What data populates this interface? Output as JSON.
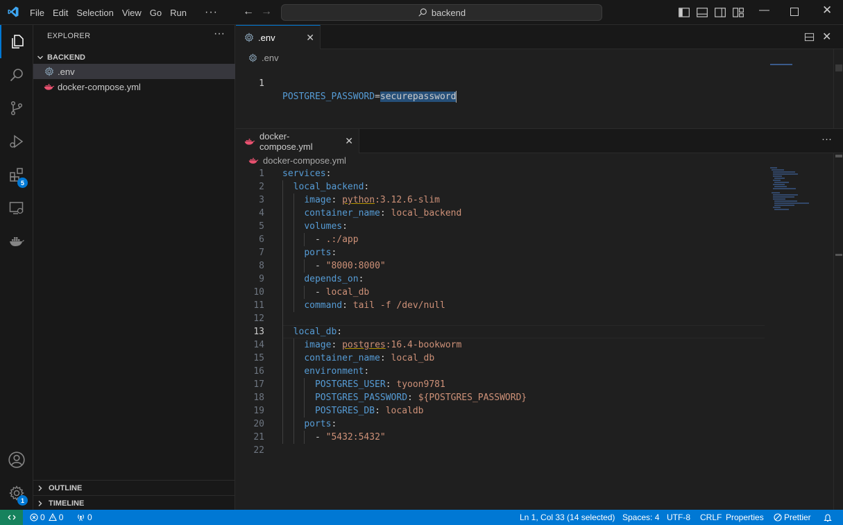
{
  "titlebar": {
    "menu": [
      "File",
      "Edit",
      "Selection",
      "View",
      "Go",
      "Run"
    ],
    "more": "···",
    "search_text": "backend"
  },
  "activity": {
    "extensions_badge": "5",
    "settings_badge": "1"
  },
  "sidebar": {
    "title": "EXPLORER",
    "more": "···",
    "folder": "BACKEND",
    "files": [
      ".env",
      "docker-compose.yml"
    ],
    "outline": "OUTLINE",
    "timeline": "TIMELINE"
  },
  "editor_top": {
    "tab_label": ".env",
    "breadcrumb": ".env",
    "line_number": "1",
    "key": "POSTGRES_PASSWORD",
    "eq": "=",
    "value": "securepassword"
  },
  "editor_bottom": {
    "tab_label": "docker-compose.yml",
    "breadcrumb": "docker-compose.yml",
    "more": "···",
    "current_line": 13,
    "lines": [
      {
        "n": "1",
        "indent": 0,
        "tokens": [
          [
            "k",
            "services"
          ],
          [
            "p",
            ":"
          ]
        ]
      },
      {
        "n": "2",
        "indent": 1,
        "tokens": [
          [
            "k",
            "local_backend"
          ],
          [
            "p",
            ":"
          ]
        ]
      },
      {
        "n": "3",
        "indent": 2,
        "tokens": [
          [
            "k",
            "image"
          ],
          [
            "p",
            ": "
          ],
          [
            "su",
            "python"
          ],
          [
            "s",
            ":3.12.6-slim"
          ]
        ]
      },
      {
        "n": "4",
        "indent": 2,
        "tokens": [
          [
            "k",
            "container_name"
          ],
          [
            "p",
            ": "
          ],
          [
            "s",
            "local_backend"
          ]
        ]
      },
      {
        "n": "5",
        "indent": 2,
        "tokens": [
          [
            "k",
            "volumes"
          ],
          [
            "p",
            ":"
          ]
        ]
      },
      {
        "n": "6",
        "indent": 3,
        "tokens": [
          [
            "p",
            "- "
          ],
          [
            "s",
            ".:/app"
          ]
        ]
      },
      {
        "n": "7",
        "indent": 2,
        "tokens": [
          [
            "k",
            "ports"
          ],
          [
            "p",
            ":"
          ]
        ]
      },
      {
        "n": "8",
        "indent": 3,
        "tokens": [
          [
            "p",
            "- "
          ],
          [
            "s",
            "\"8000:8000\""
          ]
        ]
      },
      {
        "n": "9",
        "indent": 2,
        "tokens": [
          [
            "k",
            "depends_on"
          ],
          [
            "p",
            ":"
          ]
        ]
      },
      {
        "n": "10",
        "indent": 3,
        "tokens": [
          [
            "p",
            "- "
          ],
          [
            "s",
            "local_db"
          ]
        ]
      },
      {
        "n": "11",
        "indent": 2,
        "tokens": [
          [
            "k",
            "command"
          ],
          [
            "p",
            ": "
          ],
          [
            "s",
            "tail -f /dev/null"
          ]
        ]
      },
      {
        "n": "12",
        "indent": 0,
        "tokens": []
      },
      {
        "n": "13",
        "indent": 1,
        "tokens": [
          [
            "k",
            "local_db"
          ],
          [
            "p",
            ":"
          ]
        ]
      },
      {
        "n": "14",
        "indent": 2,
        "tokens": [
          [
            "k",
            "image"
          ],
          [
            "p",
            ": "
          ],
          [
            "su",
            "postgres"
          ],
          [
            "s",
            ":16.4-bookworm"
          ]
        ]
      },
      {
        "n": "15",
        "indent": 2,
        "tokens": [
          [
            "k",
            "container_name"
          ],
          [
            "p",
            ": "
          ],
          [
            "s",
            "local_db"
          ]
        ]
      },
      {
        "n": "16",
        "indent": 2,
        "tokens": [
          [
            "k",
            "environment"
          ],
          [
            "p",
            ":"
          ]
        ]
      },
      {
        "n": "17",
        "indent": 3,
        "tokens": [
          [
            "k",
            "POSTGRES_USER"
          ],
          [
            "p",
            ": "
          ],
          [
            "s",
            "tyoon9781"
          ]
        ]
      },
      {
        "n": "18",
        "indent": 3,
        "tokens": [
          [
            "k",
            "POSTGRES_PASSWORD"
          ],
          [
            "p",
            ": "
          ],
          [
            "s",
            "${POSTGRES_PASSWORD}"
          ]
        ]
      },
      {
        "n": "19",
        "indent": 3,
        "tokens": [
          [
            "k",
            "POSTGRES_DB"
          ],
          [
            "p",
            ": "
          ],
          [
            "s",
            "localdb"
          ]
        ]
      },
      {
        "n": "20",
        "indent": 2,
        "tokens": [
          [
            "k",
            "ports"
          ],
          [
            "p",
            ":"
          ]
        ]
      },
      {
        "n": "21",
        "indent": 3,
        "tokens": [
          [
            "p",
            "- "
          ],
          [
            "s",
            "\"5432:5432\""
          ]
        ]
      },
      {
        "n": "22",
        "indent": 0,
        "tokens": []
      }
    ]
  },
  "colors": {
    "accent": "#0078d4",
    "keyword": "#569cd6",
    "string": "#ce9178",
    "remote": "#16825d"
  },
  "statusbar": {
    "errors": "0",
    "warnings": "0",
    "ports": "0",
    "cursor": "Ln 1, Col 33 (14 selected)",
    "spaces": "Spaces: 4",
    "encoding": "UTF-8",
    "eol": "CRLF",
    "language": "Properties",
    "prettier": "Prettier"
  }
}
